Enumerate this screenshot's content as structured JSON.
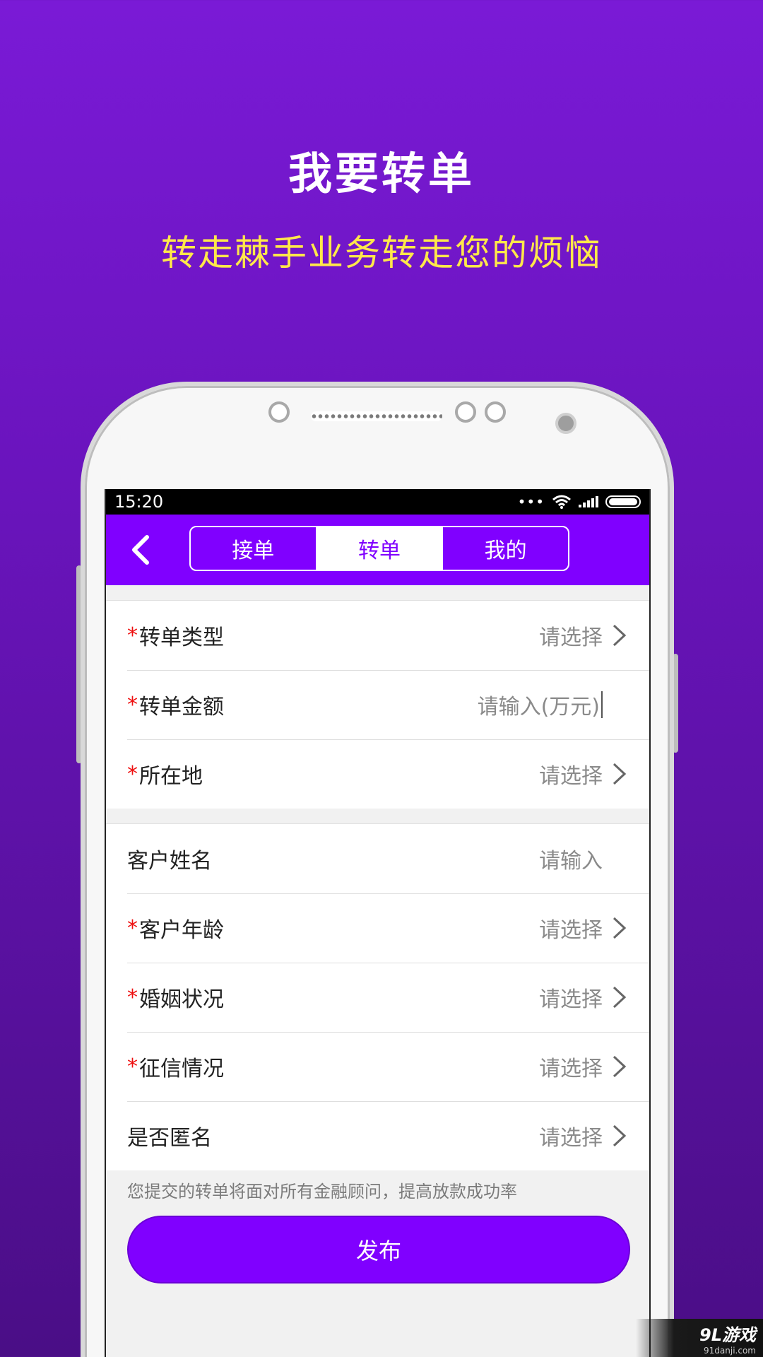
{
  "hero": {
    "title": "我要转单",
    "subtitle": "转走棘手业务转走您的烦恼"
  },
  "status_bar": {
    "time": "15:20"
  },
  "nav": {
    "tabs": [
      {
        "label": "接单",
        "active": false
      },
      {
        "label": "转单",
        "active": true
      },
      {
        "label": "我的",
        "active": false
      }
    ]
  },
  "form": {
    "group1": [
      {
        "label": "转单类型",
        "required": true,
        "value": "请选择",
        "type": "select"
      },
      {
        "label": "转单金额",
        "required": true,
        "value": "请输入(万元)",
        "type": "input"
      },
      {
        "label": "所在地",
        "required": true,
        "value": "请选择",
        "type": "select"
      }
    ],
    "group2": [
      {
        "label": "客户姓名",
        "required": false,
        "value": "请输入",
        "type": "input"
      },
      {
        "label": "客户年龄",
        "required": true,
        "value": "请选择",
        "type": "select"
      },
      {
        "label": "婚姻状况",
        "required": true,
        "value": "请选择",
        "type": "select"
      },
      {
        "label": "征信情况",
        "required": true,
        "value": "请选择",
        "type": "select"
      },
      {
        "label": "是否匿名",
        "required": false,
        "value": "请选择",
        "type": "select"
      }
    ],
    "required_mark": "*"
  },
  "hint": "您提交的转单将面对所有金融顾问，提高放款成功率",
  "publish_label": "发布",
  "watermark": {
    "main": "9L游戏",
    "sub": "91danji.com"
  },
  "colors": {
    "accent": "#8000ff",
    "subtitle": "#ffe84a",
    "required": "#ee1111"
  }
}
